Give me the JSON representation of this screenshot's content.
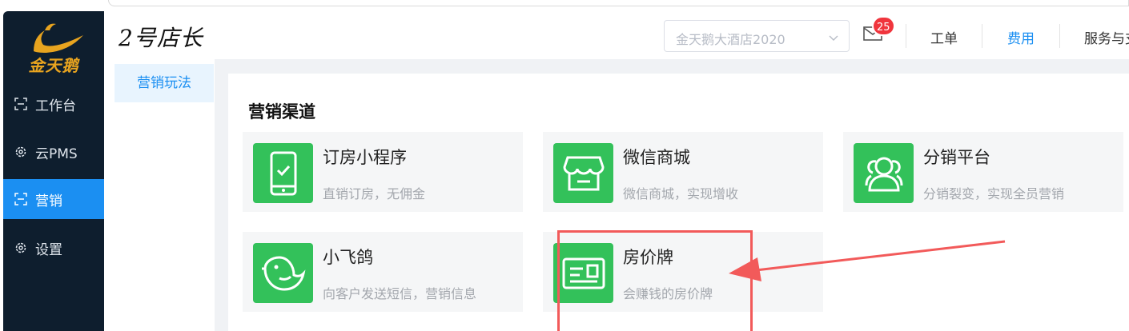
{
  "brand": {
    "logo_text": "金天鹅",
    "title": "2号店长"
  },
  "sidebar": {
    "items": [
      {
        "label": "工作台",
        "icon": "frame-icon",
        "active": false
      },
      {
        "label": "云PMS",
        "icon": "gear-icon",
        "active": false
      },
      {
        "label": "营销",
        "icon": "frame-icon",
        "active": true
      },
      {
        "label": "设置",
        "icon": "gear-icon",
        "active": false
      }
    ]
  },
  "header": {
    "hotel_select": {
      "value": "金天鹅大酒店2020"
    },
    "message_count": "25",
    "links": [
      "工单",
      "费用",
      "服务与支"
    ]
  },
  "subnav": {
    "items": [
      {
        "label": "营销玩法",
        "active": true
      }
    ]
  },
  "main": {
    "section_title": "营销渠道",
    "cards": [
      {
        "title": "订房小程序",
        "desc": "直销订房，无佣金",
        "icon": "phone-check-icon"
      },
      {
        "title": "微信商城",
        "desc": "微信商城，实现增收",
        "icon": "store-icon"
      },
      {
        "title": "分销平台",
        "desc": "分销裂变，实现全员营销",
        "icon": "users-icon"
      },
      {
        "title": "小飞鸽",
        "desc": "向客户发送短信，营销信息",
        "icon": "bird-icon"
      },
      {
        "title": "房价牌",
        "desc": "会赚钱的房价牌",
        "icon": "id-card-icon"
      }
    ]
  },
  "colors": {
    "sidebar_bg": "#0e1e2e",
    "accent": "#1b8ff2",
    "card_icon_green": "#33c15a",
    "annotation_red": "#f25a5a",
    "badge_red": "#f0353d"
  }
}
